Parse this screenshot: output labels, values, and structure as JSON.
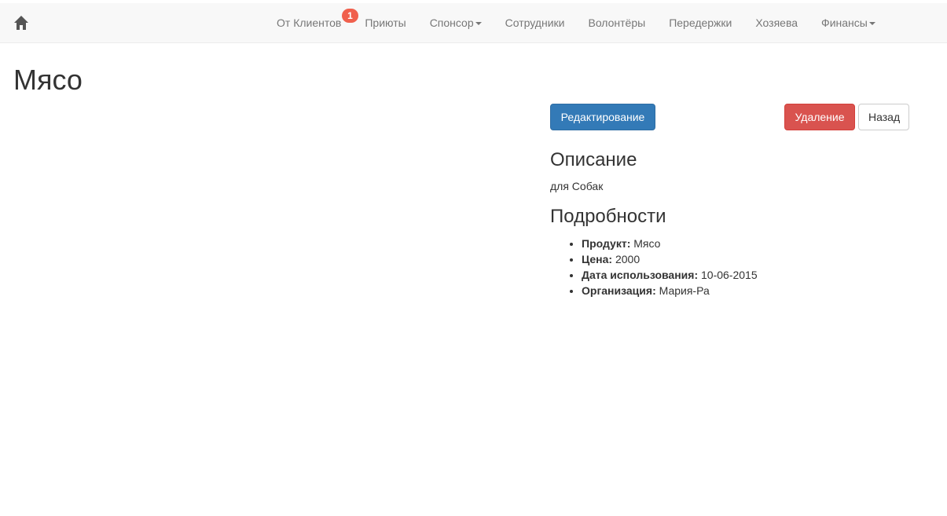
{
  "navbar": {
    "home_icon": "home-icon",
    "items": [
      {
        "label": "От Клиентов",
        "badge": "1"
      },
      {
        "label": "Приюты"
      },
      {
        "label": "Спонсор",
        "dropdown": true
      },
      {
        "label": "Сотрудники"
      },
      {
        "label": "Волонтёры"
      },
      {
        "label": "Передержки"
      },
      {
        "label": "Хозяева"
      },
      {
        "label": "Финансы",
        "dropdown": true
      }
    ]
  },
  "page": {
    "title": "Мясо"
  },
  "actions": {
    "edit_label": "Редактирование",
    "delete_label": "Удаление",
    "back_label": "Назад"
  },
  "description": {
    "title": "Описание",
    "text": "для Собак"
  },
  "details": {
    "title": "Подробности",
    "items": [
      {
        "label": "Продукт:",
        "value": "Мясо"
      },
      {
        "label": "Цена:",
        "value": "2000"
      },
      {
        "label": "Дата использования:",
        "value": "10-06-2015"
      },
      {
        "label": "Организация:",
        "value": "Мария-Ра"
      }
    ]
  },
  "colors": {
    "primary": "#337ab7",
    "danger": "#d9534f",
    "badge": "#f0604d",
    "navbar_bg": "#f8f8f8"
  }
}
